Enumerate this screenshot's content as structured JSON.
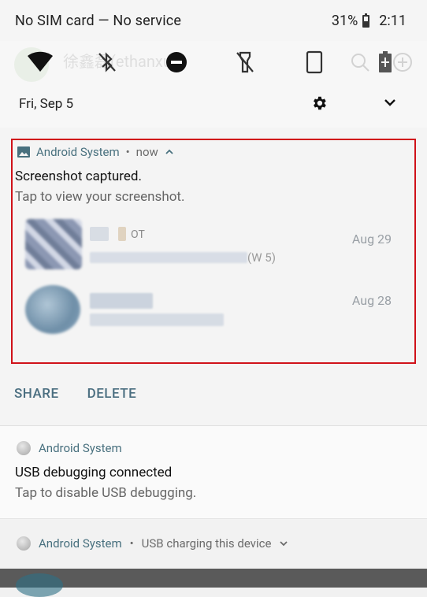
{
  "status_bar": {
    "carrier": "No SIM card — No service",
    "battery": "31%",
    "time": "2:11"
  },
  "quick_settings": {
    "date": "Fri, Sep 5",
    "ghost_name": "徐鑫磊(ethanxu)",
    "icons": [
      "wifi-icon",
      "bluetooth-off-icon",
      "dnd-icon",
      "flashlight-off-icon",
      "rotate-icon"
    ]
  },
  "notification_1": {
    "app": "Android System",
    "time": "now",
    "title": "Screenshot captured.",
    "text": "Tap to view your screenshot.",
    "preview": {
      "date_1": "Aug 29",
      "date_2": "Aug 28",
      "partial_1": "OT",
      "partial_2": "(W  5)"
    },
    "actions": [
      "SHARE",
      "DELETE"
    ]
  },
  "notification_2": {
    "app": "Android System",
    "title": "USB debugging connected",
    "text": "Tap to disable USB debugging."
  },
  "notification_3": {
    "app": "Android System",
    "summary": "USB charging this device"
  },
  "colors": {
    "accent": "#48707e",
    "highlight": "#d0121a"
  }
}
